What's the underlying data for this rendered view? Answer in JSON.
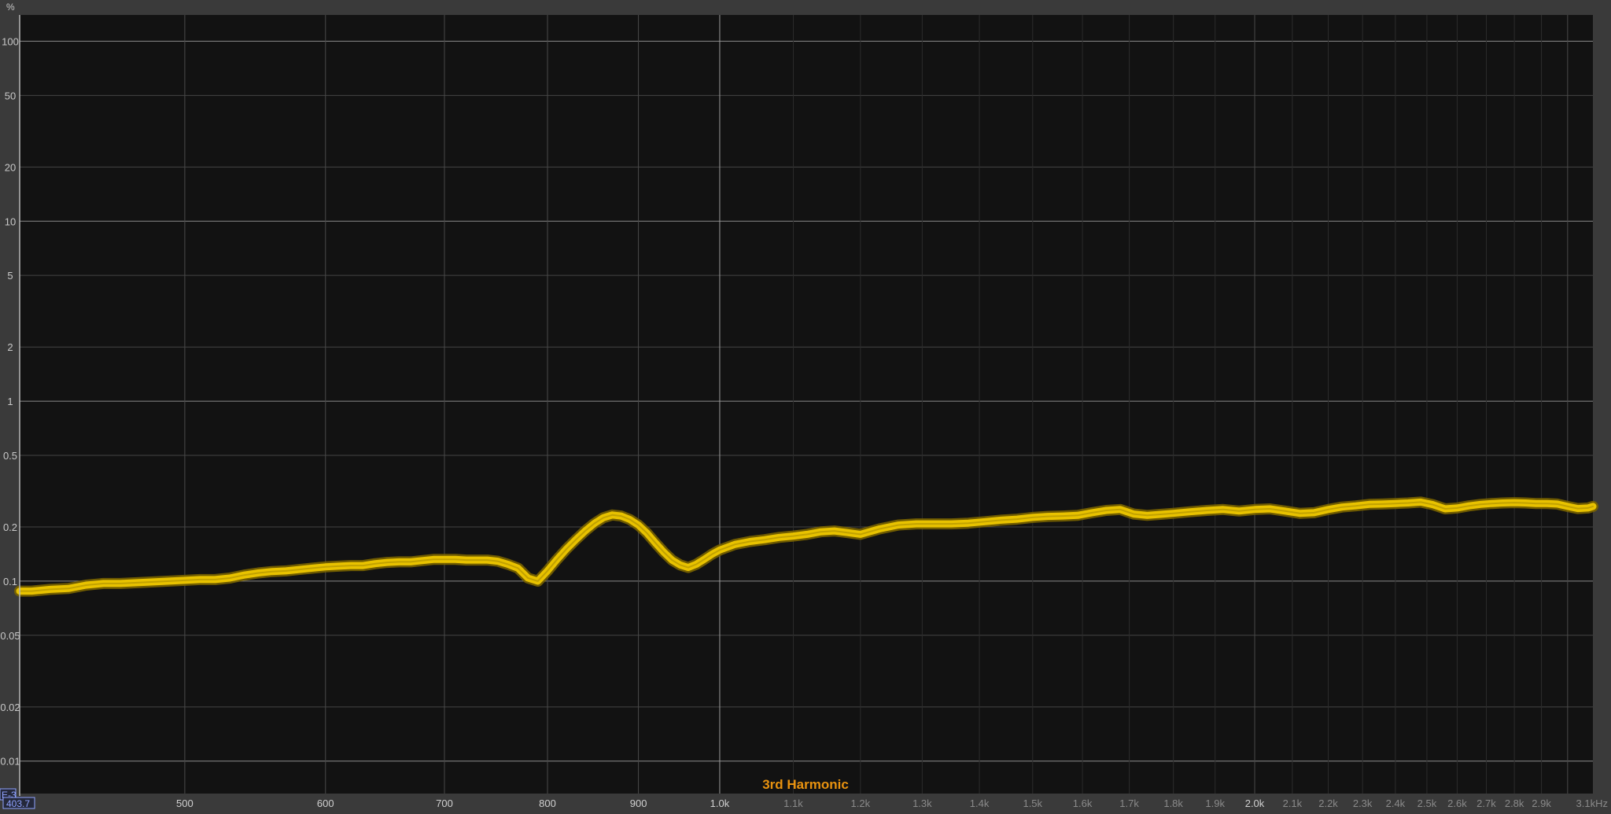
{
  "chart_data": {
    "type": "line",
    "title": "",
    "xlabel": "",
    "ylabel": "",
    "y_unit": "%",
    "x_unit": "Hz",
    "x_scale": "log",
    "y_scale": "log",
    "xlim": [
      403.7,
      3100
    ],
    "ylim": [
      0.0066,
      140
    ],
    "grid": true,
    "y_ticks": [
      {
        "value": 100,
        "label": "100"
      },
      {
        "value": 50,
        "label": "50"
      },
      {
        "value": 20,
        "label": "20"
      },
      {
        "value": 10,
        "label": "10"
      },
      {
        "value": 5,
        "label": "5"
      },
      {
        "value": 2,
        "label": "2"
      },
      {
        "value": 1,
        "label": "1"
      },
      {
        "value": 0.5,
        "label": "0.5"
      },
      {
        "value": 0.2,
        "label": "0.2"
      },
      {
        "value": 0.1,
        "label": "0.1"
      },
      {
        "value": 0.05,
        "label": "0.05"
      },
      {
        "value": 0.02,
        "label": "0.02"
      },
      {
        "value": 0.01,
        "label": "0.01"
      }
    ],
    "y_major_lines": [
      100,
      10,
      1,
      0.1,
      0.01
    ],
    "x_ticks": [
      {
        "value": 500,
        "label": "500",
        "major": true
      },
      {
        "value": 600,
        "label": "600",
        "major": true
      },
      {
        "value": 700,
        "label": "700",
        "major": true
      },
      {
        "value": 800,
        "label": "800",
        "major": true
      },
      {
        "value": 900,
        "label": "900",
        "major": true
      },
      {
        "value": 1000,
        "label": "1.0k",
        "major": true
      },
      {
        "value": 1100,
        "label": "1.1k",
        "major": false
      },
      {
        "value": 1200,
        "label": "1.2k",
        "major": false
      },
      {
        "value": 1300,
        "label": "1.3k",
        "major": false
      },
      {
        "value": 1400,
        "label": "1.4k",
        "major": false
      },
      {
        "value": 1500,
        "label": "1.5k",
        "major": false
      },
      {
        "value": 1600,
        "label": "1.6k",
        "major": false
      },
      {
        "value": 1700,
        "label": "1.7k",
        "major": false
      },
      {
        "value": 1800,
        "label": "1.8k",
        "major": false
      },
      {
        "value": 1900,
        "label": "1.9k",
        "major": false
      },
      {
        "value": 2000,
        "label": "2.0k",
        "major": true
      },
      {
        "value": 2100,
        "label": "2.1k",
        "major": false
      },
      {
        "value": 2200,
        "label": "2.2k",
        "major": false
      },
      {
        "value": 2300,
        "label": "2.3k",
        "major": false
      },
      {
        "value": 2400,
        "label": "2.4k",
        "major": false
      },
      {
        "value": 2500,
        "label": "2.5k",
        "major": false
      },
      {
        "value": 2600,
        "label": "2.6k",
        "major": false
      },
      {
        "value": 2700,
        "label": "2.7k",
        "major": false
      },
      {
        "value": 2800,
        "label": "2.8k",
        "major": false
      },
      {
        "value": 2900,
        "label": "2.9k",
        "major": false
      },
      {
        "value": 3000,
        "label": "",
        "major": true
      },
      {
        "value": 3100,
        "label": "3.1kHz",
        "major": false
      }
    ],
    "cursor": {
      "x_value": 403.7,
      "x_label": "403.7",
      "y_label": "E-3"
    },
    "series": [
      {
        "name": "3rd Harmonic",
        "color": "#e8c200",
        "x": [
          403.7,
          410,
          420,
          430,
          440,
          450,
          460,
          470,
          480,
          490,
          500,
          510,
          520,
          530,
          540,
          550,
          560,
          570,
          580,
          590,
          600,
          610,
          620,
          630,
          640,
          650,
          660,
          670,
          680,
          690,
          700,
          710,
          720,
          730,
          740,
          750,
          760,
          770,
          780,
          790,
          800,
          810,
          820,
          830,
          840,
          850,
          860,
          870,
          880,
          890,
          900,
          910,
          920,
          930,
          940,
          950,
          960,
          970,
          980,
          990,
          1000,
          1020,
          1040,
          1060,
          1080,
          1100,
          1120,
          1140,
          1160,
          1180,
          1200,
          1230,
          1260,
          1290,
          1320,
          1350,
          1380,
          1410,
          1440,
          1470,
          1500,
          1530,
          1560,
          1590,
          1620,
          1650,
          1680,
          1710,
          1740,
          1770,
          1800,
          1840,
          1880,
          1920,
          1960,
          2000,
          2040,
          2080,
          2120,
          2160,
          2200,
          2240,
          2280,
          2320,
          2360,
          2400,
          2440,
          2480,
          2520,
          2560,
          2600,
          2640,
          2680,
          2720,
          2760,
          2800,
          2840,
          2880,
          2920,
          2960,
          3000,
          3040,
          3080,
          3100
        ],
        "values": [
          0.088,
          0.088,
          0.09,
          0.091,
          0.095,
          0.097,
          0.097,
          0.098,
          0.099,
          0.1,
          0.101,
          0.102,
          0.102,
          0.104,
          0.108,
          0.111,
          0.113,
          0.114,
          0.116,
          0.118,
          0.12,
          0.121,
          0.122,
          0.122,
          0.125,
          0.127,
          0.128,
          0.128,
          0.13,
          0.132,
          0.132,
          0.132,
          0.131,
          0.131,
          0.131,
          0.129,
          0.124,
          0.118,
          0.104,
          0.1,
          0.114,
          0.132,
          0.151,
          0.17,
          0.19,
          0.209,
          0.225,
          0.233,
          0.23,
          0.22,
          0.205,
          0.185,
          0.163,
          0.145,
          0.131,
          0.123,
          0.119,
          0.124,
          0.132,
          0.141,
          0.149,
          0.16,
          0.166,
          0.17,
          0.175,
          0.178,
          0.182,
          0.188,
          0.19,
          0.186,
          0.182,
          0.195,
          0.205,
          0.208,
          0.208,
          0.208,
          0.21,
          0.214,
          0.218,
          0.221,
          0.226,
          0.229,
          0.23,
          0.232,
          0.24,
          0.247,
          0.25,
          0.236,
          0.232,
          0.235,
          0.238,
          0.243,
          0.247,
          0.25,
          0.245,
          0.25,
          0.252,
          0.245,
          0.238,
          0.24,
          0.25,
          0.258,
          0.262,
          0.267,
          0.268,
          0.27,
          0.272,
          0.275,
          0.266,
          0.252,
          0.255,
          0.262,
          0.267,
          0.27,
          0.272,
          0.273,
          0.272,
          0.27,
          0.27,
          0.268,
          0.26,
          0.253,
          0.255,
          0.26
        ]
      }
    ]
  }
}
